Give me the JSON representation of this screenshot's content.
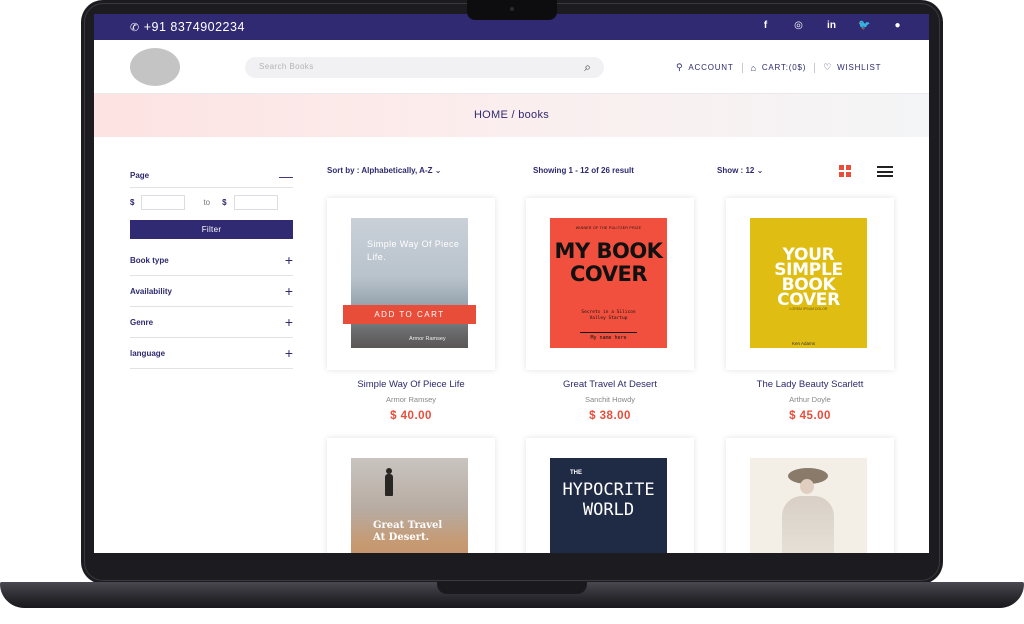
{
  "topbar": {
    "phone": "+91 8374902234",
    "socials": [
      "f",
      "◎",
      "in",
      "🐦",
      "●"
    ]
  },
  "header": {
    "search_placeholder": "Search Books",
    "account": "ACCOUNT",
    "cart": "CART:(0$)",
    "wishlist": "WISHLIST"
  },
  "breadcrumb": "HOME  /  books",
  "sidebar": {
    "page_label": "Page",
    "currency": "$",
    "to": "to",
    "filter_button": "Filter",
    "sections": [
      "Book type",
      "Availability",
      "Genre",
      "language"
    ]
  },
  "toolbar": {
    "sort": "Sort by : Alphabetically, A-Z",
    "showing": "Showing 1 - 12 of 26 result",
    "show": "Show : 12"
  },
  "products": [
    {
      "title": "Simple Way Of Piece Life",
      "author": "Armor Ramsey",
      "price": "$ 40.00",
      "cover_title": "Simple Way Of Piece Life.",
      "cover_author": "Armor Ramsey",
      "add_to_cart": "ADD TO CART"
    },
    {
      "title": "Great Travel At Desert",
      "author": "Sanchit Howdy",
      "price": "$ 38.00",
      "cover_top": "WINNER OF THE PULITZER PRIZE",
      "cover_title": "MY BOOK COVER",
      "cover_sub": "Secrets in a Silicon Valley Startup",
      "cover_name": "My name here"
    },
    {
      "title": "The Lady Beauty Scarlett",
      "author": "Arthur Doyle",
      "price": "$ 45.00",
      "cover_title": "YOUR SIMPLE BOOK COVER",
      "cover_sub": "LOREM IPSUM DOLOR",
      "cover_author": "Ken Adams"
    },
    {
      "cover_title": "Great Travel At Desert."
    },
    {
      "cover_the": "THE",
      "cover_title": "HYPOCRITE WORLD"
    },
    {}
  ]
}
